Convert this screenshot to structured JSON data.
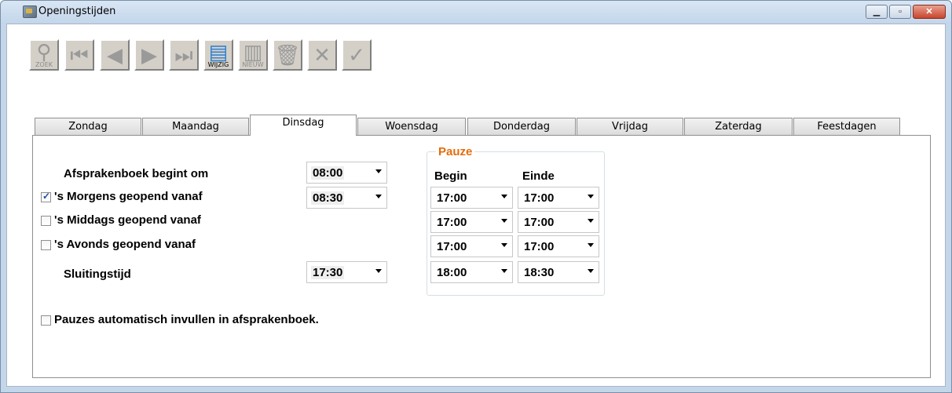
{
  "window": {
    "title": "Openingstijden"
  },
  "toolbar": {
    "buttons": [
      {
        "name": "zoek",
        "caption": "ZOEK",
        "glyph": "⚲"
      },
      {
        "name": "first",
        "caption": "",
        "glyph": "⏮"
      },
      {
        "name": "prev",
        "caption": "",
        "glyph": "◀"
      },
      {
        "name": "next",
        "caption": "",
        "glyph": "▶"
      },
      {
        "name": "last",
        "caption": "",
        "glyph": "⏭"
      },
      {
        "name": "wijzig",
        "caption": "WIJZIG",
        "glyph": "▤"
      },
      {
        "name": "nieuw",
        "caption": "NIEUW",
        "glyph": "▥"
      },
      {
        "name": "delete",
        "caption": "",
        "glyph": "🗑"
      },
      {
        "name": "cancel",
        "caption": "",
        "glyph": "✕"
      },
      {
        "name": "confirm",
        "caption": "",
        "glyph": "✓"
      }
    ]
  },
  "tabs": [
    "Zondag",
    "Maandag",
    "Dinsdag",
    "Woensdag",
    "Donderdag",
    "Vrijdag",
    "Zaterdag",
    "Feestdagen"
  ],
  "selected_tab": "Dinsdag",
  "form": {
    "afsprakenboek_label": "Afsprakenboek begint om",
    "afsprakenboek_value": "08:00",
    "morgens_label": "'s Morgens geopend vanaf",
    "morgens_checked": true,
    "morgens_value": "08:30",
    "middags_label": "'s Middags geopend vanaf",
    "middags_checked": false,
    "avonds_label": "'s Avonds geopend vanaf",
    "avonds_checked": false,
    "sluitingstijd_label": "Sluitingstijd",
    "sluitingstijd_value": "17:30",
    "pauzes_label": "Pauzes automatisch invullen in afsprakenboek.",
    "pauzes_checked": false
  },
  "pauze": {
    "title": "Pauze",
    "begin_label": "Begin",
    "einde_label": "Einde",
    "rows": [
      {
        "begin": "17:00",
        "einde": "17:00"
      },
      {
        "begin": "17:00",
        "einde": "17:00"
      },
      {
        "begin": "17:00",
        "einde": "17:00"
      },
      {
        "begin": "18:00",
        "einde": "18:30"
      }
    ]
  }
}
